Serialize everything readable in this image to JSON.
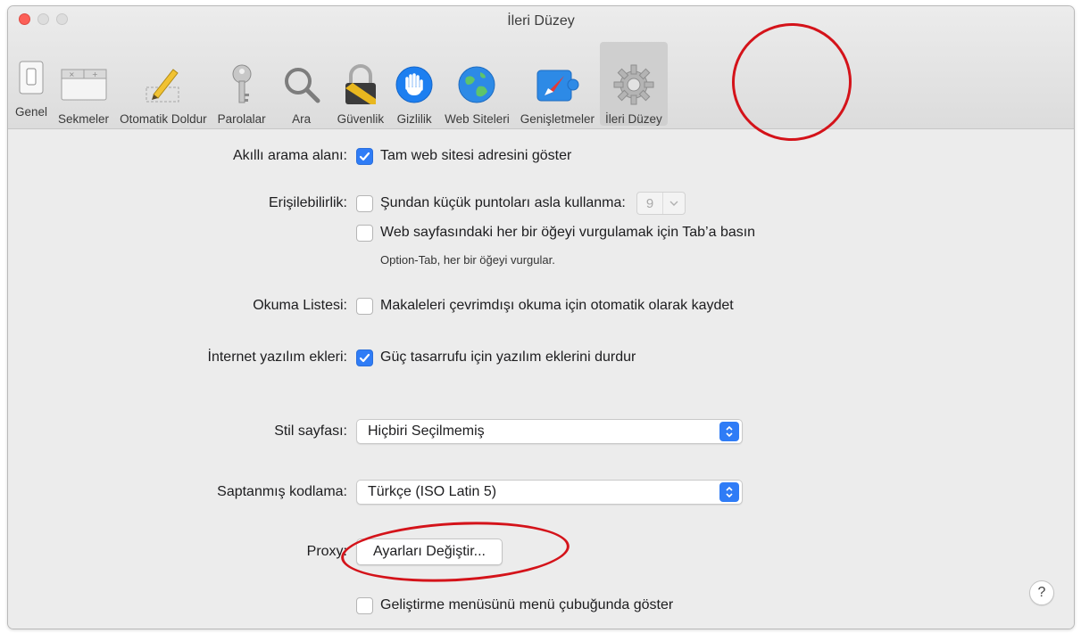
{
  "window": {
    "title": "İleri Düzey"
  },
  "toolbar": {
    "items": [
      {
        "label": "Genel",
        "icon": "general-switch-icon"
      },
      {
        "label": "Sekmeler",
        "icon": "tabs-icon"
      },
      {
        "label": "Otomatik Doldur",
        "icon": "pencil-icon"
      },
      {
        "label": "Parolalar",
        "icon": "key-icon"
      },
      {
        "label": "Ara",
        "icon": "magnifier-icon"
      },
      {
        "label": "Güvenlik",
        "icon": "lock-icon"
      },
      {
        "label": "Gizlilik",
        "icon": "hand-icon"
      },
      {
        "label": "Web Siteleri",
        "icon": "globe-icon"
      },
      {
        "label": "Genişletmeler",
        "icon": "puzzle-compass-icon"
      },
      {
        "label": "İleri Düzey",
        "icon": "gear-icon",
        "selected": true
      }
    ]
  },
  "settings": {
    "smart_search": {
      "label": "Akıllı arama alanı:",
      "checkbox": "Tam web sitesi adresini göster",
      "checked": true
    },
    "accessibility": {
      "label": "Erişilebilirlik:",
      "font_checkbox": "Şundan küçük puntoları asla kullanma:",
      "font_checked": false,
      "font_value": "9",
      "tab_checkbox": "Web sayfasındaki her bir öğeyi vurgulamak için Tab’a basın",
      "tab_checked": false,
      "tab_note": "Option-Tab, her bir öğeyi vurgular."
    },
    "reading_list": {
      "label": "Okuma Listesi:",
      "checkbox": "Makaleleri çevrimdışı okuma için otomatik olarak kaydet",
      "checked": false
    },
    "plugins": {
      "label": "İnternet yazılım ekleri:",
      "checkbox": "Güç tasarrufu için yazılım eklerini durdur",
      "checked": true
    },
    "style_sheet": {
      "label": "Stil sayfası:",
      "value": "Hiçbiri Seçilmemiş"
    },
    "encoding": {
      "label": "Saptanmış kodlama:",
      "value": "Türkçe (ISO Latin 5)"
    },
    "proxy": {
      "label": "Proxy:",
      "button": "Ayarları Değiştir..."
    },
    "develop_menu": {
      "checkbox": "Geliştirme menüsünü menü çubuğunda göster",
      "checked": false
    }
  },
  "help": {
    "label": "?"
  },
  "colors": {
    "accent": "#2f7cf6",
    "annotation": "#d4131a"
  }
}
